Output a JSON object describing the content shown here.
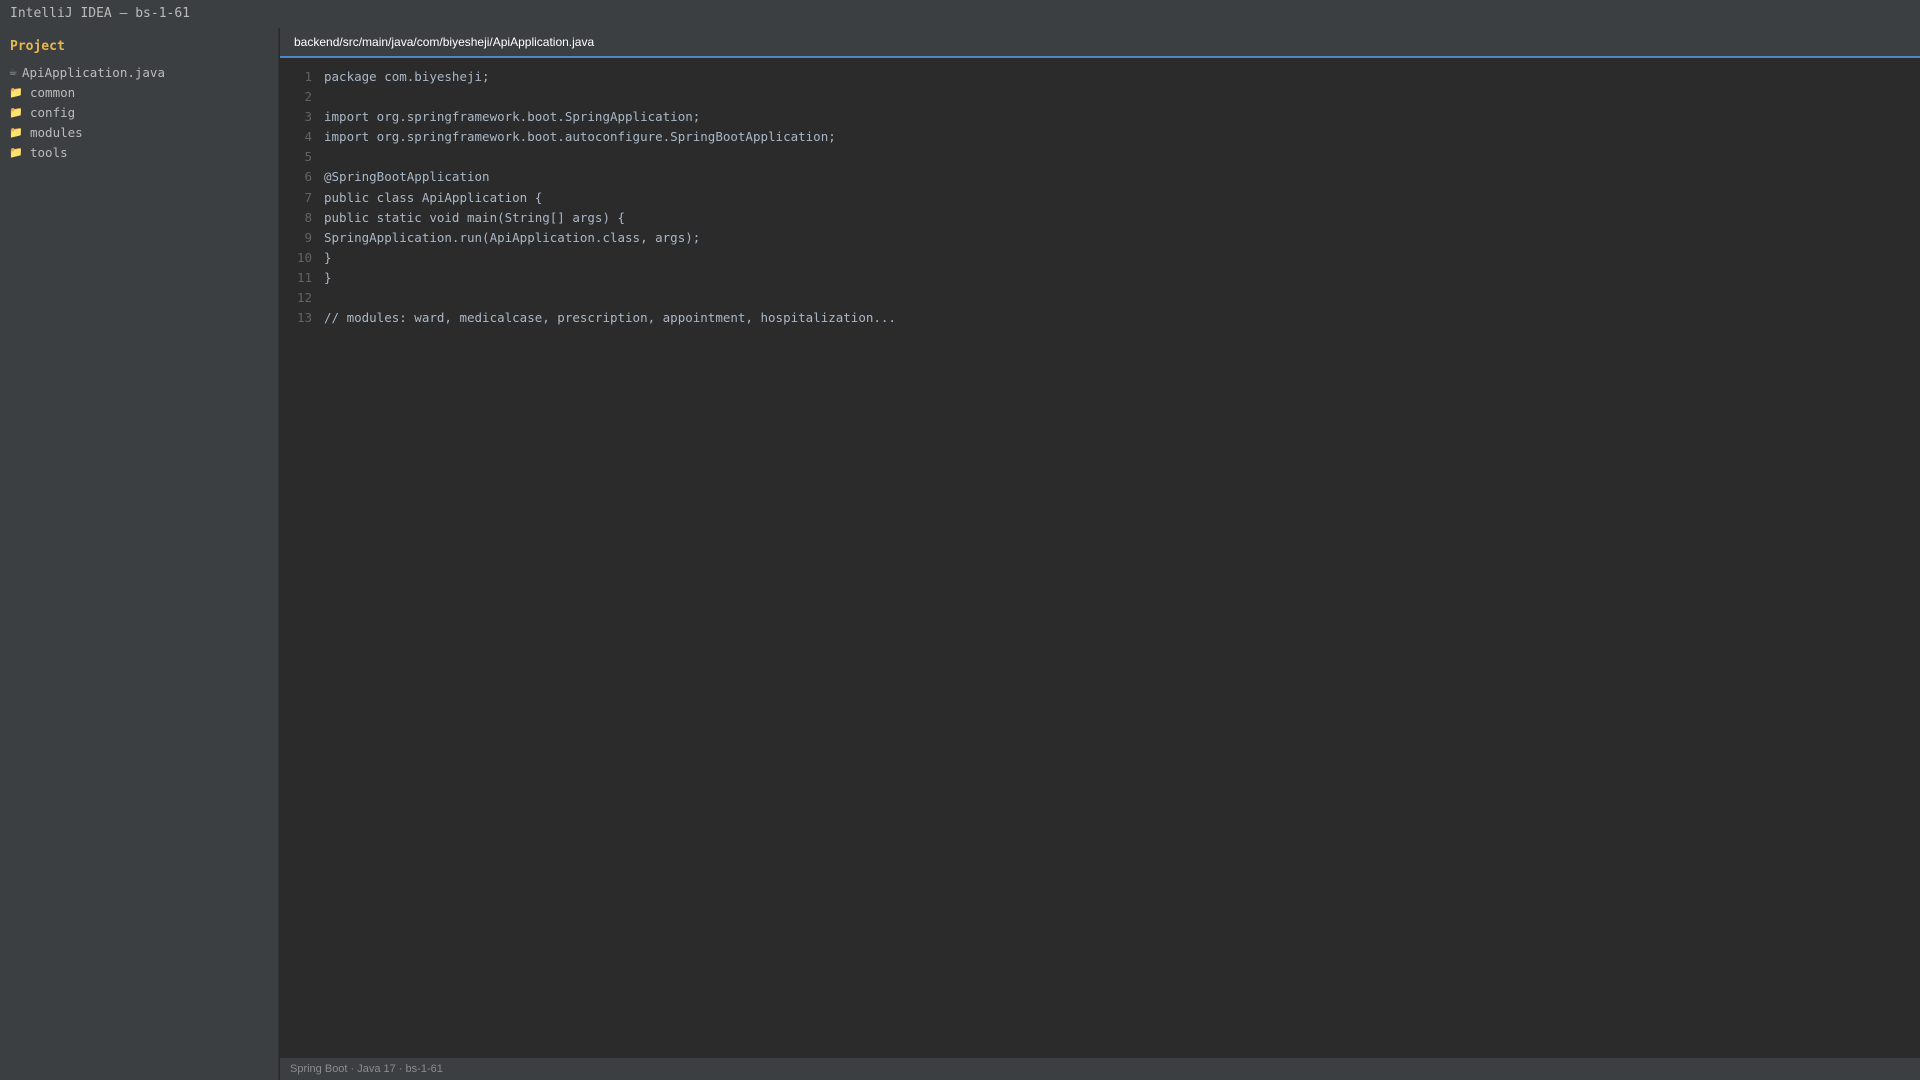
{
  "window": {
    "title": "IntelliJ IDEA — bs-1-61"
  },
  "sidebar": {
    "title": "Project",
    "items": [
      {
        "label": "ApiApplication.java",
        "icon": "java-file-icon"
      },
      {
        "label": "common",
        "icon": "folder-icon"
      },
      {
        "label": "config",
        "icon": "folder-icon"
      },
      {
        "label": "modules",
        "icon": "folder-icon"
      },
      {
        "label": "tools",
        "icon": "folder-icon"
      }
    ]
  },
  "editor": {
    "tab_path": "backend/src/main/java/com/biyesheji/ApiApplication.java",
    "lines": [
      {
        "no": "1",
        "text": "package com.biyesheji;"
      },
      {
        "no": "2",
        "text": ""
      },
      {
        "no": "3",
        "text": "import org.springframework.boot.SpringApplication;"
      },
      {
        "no": "4",
        "text": "import org.springframework.boot.autoconfigure.SpringBootApplication;"
      },
      {
        "no": "5",
        "text": ""
      },
      {
        "no": "6",
        "text": "@SpringBootApplication"
      },
      {
        "no": "7",
        "text": "public class ApiApplication {"
      },
      {
        "no": "8",
        "text": "public static void main(String[] args) {"
      },
      {
        "no": "9",
        "text": "SpringApplication.run(ApiApplication.class, args);"
      },
      {
        "no": "10",
        "text": "}"
      },
      {
        "no": "11",
        "text": "}"
      },
      {
        "no": "12",
        "text": ""
      },
      {
        "no": "13",
        "text": "// modules: ward, medicalcase, prescription, appointment, hospitalization..."
      }
    ]
  },
  "statusbar": {
    "text": "Spring Boot · Java 17 · bs-1-61"
  }
}
